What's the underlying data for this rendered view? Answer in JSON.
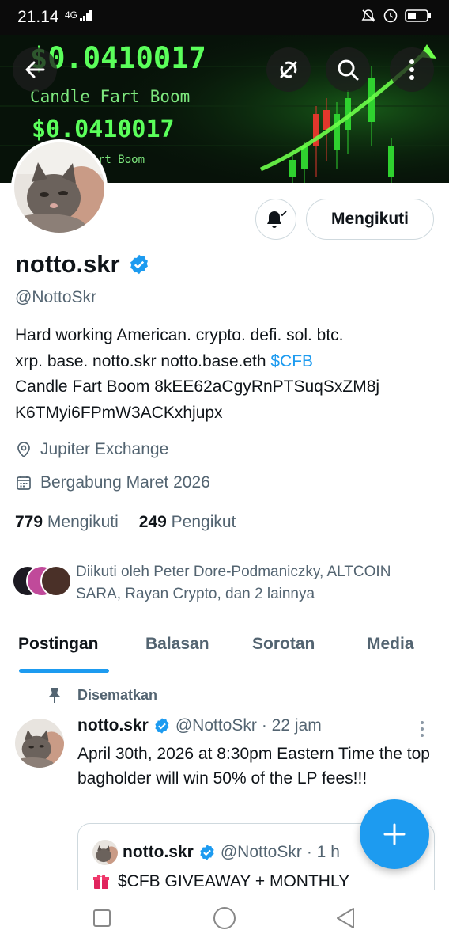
{
  "status_bar": {
    "time": "21.14",
    "network": "4G",
    "icons": [
      "mute-icon",
      "alarm-icon",
      "battery-icon"
    ]
  },
  "banner": {
    "price_big": "$0.0410017",
    "tagline": "Candle Fart Boom",
    "price_secondary": "$0.0410017",
    "tagline_partial": "rt Boom",
    "colors": {
      "background": "#071209",
      "text": "#5bff5b",
      "candle_up": "#2fd12f",
      "candle_down": "#e0372c"
    }
  },
  "header_buttons": [
    "back-arrow-icon",
    "grok-icon",
    "search-icon",
    "more-vertical-icon"
  ],
  "profile": {
    "name": "notto.skr",
    "handle": "@NottoSkr",
    "verified": true,
    "bio_lines": [
      {
        "text": "Hard working American. crypto. defi. sol. btc.",
        "cashtag": ""
      },
      {
        "text": "xrp. base. notto.skr    notto.base.eth ",
        "cashtag": "$CFB"
      },
      {
        "text": "Candle Fart Boom 8kEE62aCgyRnPTSuqSxZM8j",
        "cashtag": ""
      },
      {
        "text": "K6TMyi6FPmW3ACKxhjupx",
        "cashtag": ""
      }
    ],
    "location": "Jupiter Exchange",
    "joined": "Bergabung Maret 2026",
    "following_count": "779",
    "following_label": "Mengikuti",
    "followers_count": "249",
    "followers_label": "Pengikut",
    "followed_by": "Diikuti oleh Peter Dore-Podmaniczky, ALTCOIN SARA, Rayan Crypto, dan 2 lainnya"
  },
  "actions": {
    "follow_label": "Mengikuti"
  },
  "tabs": [
    {
      "label": "Postingan",
      "active": true
    },
    {
      "label": "Balasan",
      "active": false
    },
    {
      "label": "Sorotan",
      "active": false
    },
    {
      "label": "Media",
      "active": false
    }
  ],
  "pinned_tweet": {
    "pinned_label": "Disematkan",
    "author": "notto.skr",
    "handle": "@NottoSkr",
    "time": "· 22 jam",
    "text": "April 30th, 2026 at 8:30pm Eastern Time the top bagholder will win 50% of the LP fees!!!",
    "quote": {
      "author": "notto.skr",
      "handle": "@NottoSkr",
      "time": "· 1 h",
      "text": "$CFB GIVEAWAY + MONTHLY"
    }
  },
  "accent_color": "#1d9bf0"
}
